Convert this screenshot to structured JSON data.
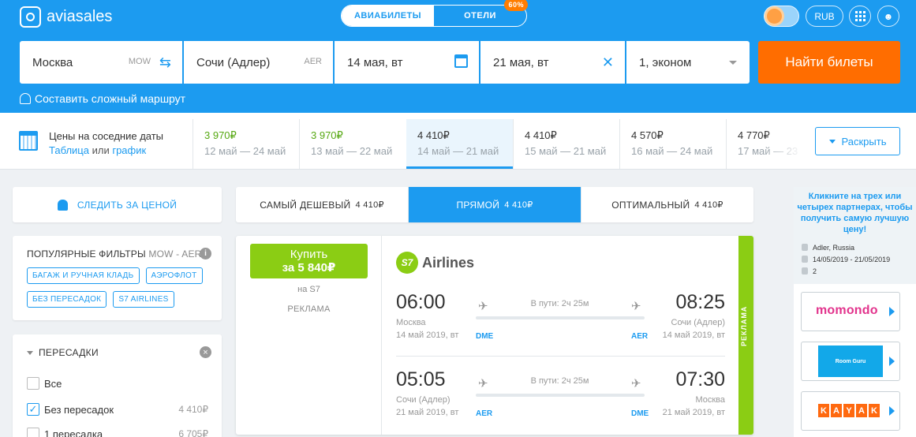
{
  "header": {
    "brand": "aviasales",
    "modes": [
      {
        "label": "АВИАБИЛЕТЫ"
      },
      {
        "label": "ОТЕЛИ",
        "badge": "60%"
      }
    ],
    "currency": "RUB"
  },
  "search": {
    "from_city": "Москва",
    "from_code": "MOW",
    "to_city": "Сочи (Адлер)",
    "to_code": "AER",
    "depart_date": "14 мая, вт",
    "return_date": "21 мая, вт",
    "passengers": "1, эконом",
    "find_button": "Найти билеты",
    "complex_route": "Составить сложный маршрут"
  },
  "dates_strip": {
    "title": "Цены на соседние даты",
    "sub_table": "Таблица",
    "sub_or": " или ",
    "sub_chart": "график",
    "cells": [
      {
        "price": "3 970₽",
        "range": "12 май — 24 май"
      },
      {
        "price": "3 970₽",
        "range": "13 май — 22 май"
      },
      {
        "price": "4 410₽",
        "range": "14 май — 21 май"
      },
      {
        "price": "4 410₽",
        "range": "15 май — 21 май"
      },
      {
        "price": "4 570₽",
        "range": "16 май — 24 май"
      },
      {
        "price": "4 770₽",
        "range": "17 май — 23"
      }
    ],
    "expand": "Раскрыть"
  },
  "sidebar": {
    "watch_price": "СЛЕДИТЬ ЗА ЦЕНОЙ",
    "popular_title": "ПОПУЛЯРНЫЕ ФИЛЬТРЫ",
    "popular_route": "MOW - AER",
    "tags": [
      "БАГАЖ И РУЧНАЯ КЛАДЬ",
      "АЭРОФЛОТ",
      "БЕЗ ПЕРЕСАДОК",
      "S7 AIRLINES"
    ],
    "transfers_title": "ПЕРЕСАДКИ",
    "options": [
      {
        "label": "Все",
        "count": ""
      },
      {
        "label": "Без пересадок",
        "count": "4 410₽"
      },
      {
        "label": "1 пересадка",
        "count": "6 705₽"
      }
    ]
  },
  "sorts": [
    {
      "label": "САМЫЙ ДЕШЕВЫЙ",
      "price": "4 410₽"
    },
    {
      "label": "ПРЯМОЙ",
      "price": "4 410₽"
    },
    {
      "label": "ОПТИМАЛЬНЫЙ",
      "price": "4 410₽"
    }
  ],
  "ticket": {
    "buy_line1": "Купить",
    "buy_line2": "за 5 840₽",
    "seller": "на S7",
    "ad_label": "РЕКЛАМА",
    "airline_logo": "S7",
    "airline_name": "Airlines",
    "ribbon": "РЕКЛАМА",
    "segments": [
      {
        "dep_time": "06:00",
        "dep_city": "Москва",
        "dep_date": "14 май 2019, вт",
        "dep_airport": "DME",
        "duration": "В пути: 2ч 25м",
        "arr_time": "08:25",
        "arr_city": "Сочи (Адлер)",
        "arr_date": "14 май 2019, вт",
        "arr_airport": "AER"
      },
      {
        "dep_time": "05:05",
        "dep_city": "Сочи (Адлер)",
        "dep_date": "21 май 2019, вт",
        "dep_airport": "AER",
        "duration": "В пути: 2ч 25м",
        "arr_time": "07:30",
        "arr_city": "Москва",
        "arr_date": "21 май 2019, вт",
        "arr_airport": "DME"
      }
    ]
  },
  "ads": {
    "text": "Кликните на трех или четырех партнерах, чтобы получить самую лучшую цену!",
    "location": "Adler, Russia",
    "dates": "14/05/2019 - 21/05/2019",
    "guests": "2",
    "partners": [
      "momondo",
      "Room Guru",
      "KAYAK"
    ]
  }
}
